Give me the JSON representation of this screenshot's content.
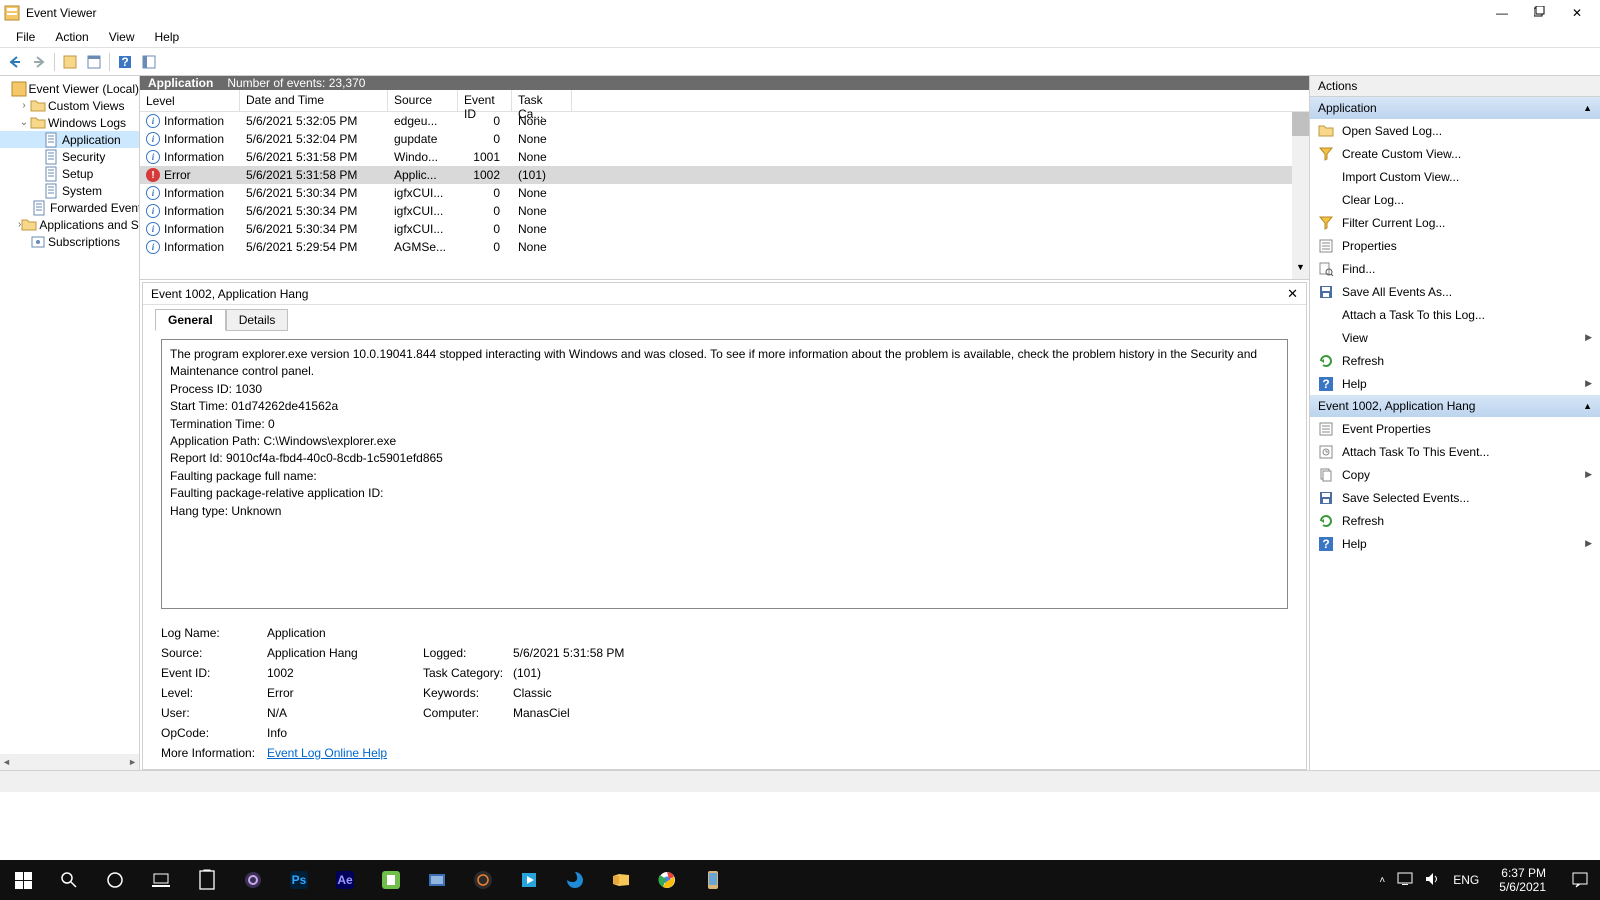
{
  "window": {
    "title": "Event Viewer"
  },
  "menu": [
    "File",
    "Action",
    "View",
    "Help"
  ],
  "tree": {
    "root": "Event Viewer (Local)",
    "nodes": [
      {
        "label": "Custom Views",
        "indent": 1,
        "exp": ">"
      },
      {
        "label": "Windows Logs",
        "indent": 1,
        "exp": "v"
      },
      {
        "label": "Application",
        "indent": 2,
        "sel": true
      },
      {
        "label": "Security",
        "indent": 2
      },
      {
        "label": "Setup",
        "indent": 2
      },
      {
        "label": "System",
        "indent": 2
      },
      {
        "label": "Forwarded Events",
        "indent": 2
      },
      {
        "label": "Applications and Services Logs",
        "indent": 1,
        "exp": ">"
      },
      {
        "label": "Subscriptions",
        "indent": 1
      }
    ]
  },
  "centerHeader": {
    "name": "Application",
    "count_label": "Number of events: 23,370"
  },
  "columns": [
    "Level",
    "Date and Time",
    "Source",
    "Event ID",
    "Task Ca..."
  ],
  "events": [
    {
      "level": "Information",
      "icon": "info",
      "date": "5/6/2021 5:32:05 PM",
      "src": "edgeu...",
      "eid": "0",
      "cat": "None"
    },
    {
      "level": "Information",
      "icon": "info",
      "date": "5/6/2021 5:32:04 PM",
      "src": "gupdate",
      "eid": "0",
      "cat": "None"
    },
    {
      "level": "Information",
      "icon": "info",
      "date": "5/6/2021 5:31:58 PM",
      "src": "Windo...",
      "eid": "1001",
      "cat": "None"
    },
    {
      "level": "Error",
      "icon": "err",
      "date": "5/6/2021 5:31:58 PM",
      "src": "Applic...",
      "eid": "1002",
      "cat": "(101)",
      "sel": true
    },
    {
      "level": "Information",
      "icon": "info",
      "date": "5/6/2021 5:30:34 PM",
      "src": "igfxCUI...",
      "eid": "0",
      "cat": "None"
    },
    {
      "level": "Information",
      "icon": "info",
      "date": "5/6/2021 5:30:34 PM",
      "src": "igfxCUI...",
      "eid": "0",
      "cat": "None"
    },
    {
      "level": "Information",
      "icon": "info",
      "date": "5/6/2021 5:30:34 PM",
      "src": "igfxCUI...",
      "eid": "0",
      "cat": "None"
    },
    {
      "level": "Information",
      "icon": "info",
      "date": "5/6/2021 5:29:54 PM",
      "src": "AGMSe...",
      "eid": "0",
      "cat": "None"
    }
  ],
  "detail": {
    "title": "Event 1002, Application Hang",
    "tabs": [
      "General",
      "Details"
    ],
    "message": "The program explorer.exe version 10.0.19041.844 stopped interacting with Windows and was closed. To see if more information about the problem is available, check the problem history in the Security and Maintenance control panel.\nProcess ID: 1030\nStart Time: 01d74262de41562a\nTermination Time: 0\nApplication Path: C:\\Windows\\explorer.exe\nReport Id: 9010cf4a-fbd4-40c0-8cdb-1c5901efd865\nFaulting package full name:\nFaulting package-relative application ID:\nHang type: Unknown",
    "props": {
      "logname": {
        "l": "Log Name:",
        "v": "Application"
      },
      "source": {
        "l": "Source:",
        "v": "Application Hang"
      },
      "logged": {
        "l": "Logged:",
        "v": "5/6/2021 5:31:58 PM"
      },
      "eventid": {
        "l": "Event ID:",
        "v": "1002"
      },
      "taskcat": {
        "l": "Task Category:",
        "v": "(101)"
      },
      "level": {
        "l": "Level:",
        "v": "Error"
      },
      "keywords": {
        "l": "Keywords:",
        "v": "Classic"
      },
      "user": {
        "l": "User:",
        "v": "N/A"
      },
      "computer": {
        "l": "Computer:",
        "v": "ManasCiel"
      },
      "opcode": {
        "l": "OpCode:",
        "v": "Info"
      },
      "more": {
        "l": "More Information:",
        "v": "Event Log Online Help"
      }
    }
  },
  "actions": {
    "title": "Actions",
    "sections": [
      {
        "header": "Application",
        "items": [
          {
            "icon": "folder",
            "label": "Open Saved Log..."
          },
          {
            "icon": "filter",
            "label": "Create Custom View..."
          },
          {
            "icon": "",
            "label": "Import Custom View..."
          },
          {
            "icon": "",
            "label": "Clear Log..."
          },
          {
            "icon": "filter",
            "label": "Filter Current Log..."
          },
          {
            "icon": "props",
            "label": "Properties"
          },
          {
            "icon": "find",
            "label": "Find..."
          },
          {
            "icon": "save",
            "label": "Save All Events As..."
          },
          {
            "icon": "",
            "label": "Attach a Task To this Log..."
          },
          {
            "icon": "",
            "label": "View",
            "arrow": true
          },
          {
            "icon": "refresh",
            "label": "Refresh"
          },
          {
            "icon": "help",
            "label": "Help",
            "arrow": true
          }
        ]
      },
      {
        "header": "Event 1002, Application Hang",
        "items": [
          {
            "icon": "props",
            "label": "Event Properties"
          },
          {
            "icon": "task",
            "label": "Attach Task To This Event..."
          },
          {
            "icon": "copy",
            "label": "Copy",
            "arrow": true
          },
          {
            "icon": "save",
            "label": "Save Selected Events..."
          },
          {
            "icon": "refresh",
            "label": "Refresh"
          },
          {
            "icon": "help",
            "label": "Help",
            "arrow": true
          }
        ]
      }
    ]
  },
  "taskbar": {
    "tray": {
      "lang": "ENG",
      "time": "6:37 PM",
      "date": "5/6/2021"
    }
  }
}
